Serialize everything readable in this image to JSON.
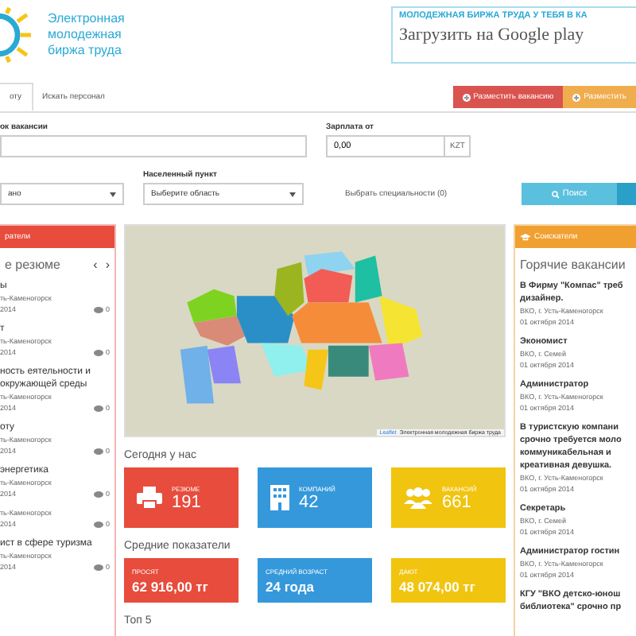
{
  "logo": {
    "lines": [
      "Электронная",
      "молодежная",
      "биржа труда"
    ]
  },
  "banner": {
    "headline": "МОЛОДЕЖНАЯ БИРЖА ТРУДА У ТЕБЯ В КА",
    "store": "Загрузить на Google play"
  },
  "tabs": [
    {
      "label": "оту",
      "selected": true
    },
    {
      "label": "Искать персонал",
      "selected": false
    }
  ],
  "actions": [
    {
      "label": "Разместить вакансию",
      "color": "#d9534f"
    },
    {
      "label": "Разместить",
      "color": "#f0ad4e"
    }
  ],
  "filters": {
    "keyword_label": "ок вакансии",
    "salary_label": "Зарплата от",
    "salary_value": "0,00",
    "currency": "KZT",
    "city_label": "Населенный пункт",
    "first_select": "ано",
    "region_placeholder": "Выберите область",
    "specialties": "Выбрать специальности (0)",
    "search_button": "Поиск"
  },
  "left_panel": {
    "header": "ратели",
    "title": "е резюме",
    "prev": "‹",
    "next": "›",
    "items": [
      {
        "title": "ы",
        "location": "ть-Каменогорск",
        "date": "2014",
        "views": "0"
      },
      {
        "title": "т",
        "location": "ть-Каменогорск",
        "date": "2014",
        "views": "0"
      },
      {
        "title": "ность еятельности и окружающей среды",
        "location": "ть-Каменогорск",
        "date": "2014",
        "views": "0"
      },
      {
        "title": "оту",
        "location": "ть-Каменогорск",
        "date": "2014",
        "views": "0"
      },
      {
        "title": "энергетика",
        "location": "ть-Каменогорск",
        "date": "2014",
        "views": "0"
      },
      {
        "location": "ть-Каменогорск",
        "date": "2014",
        "views": "0"
      },
      {
        "title": "ист в сфере туризма",
        "location": "ть-Каменогорск",
        "date": "2014",
        "views": "0"
      }
    ]
  },
  "map": {
    "attribution_link": "Leaflet",
    "attribution": "Электронная молодежная биржа труда"
  },
  "today": {
    "title": "Сегодня у нас",
    "tiles": [
      {
        "kind": "printer",
        "label": "РЕЗЮМЕ",
        "value": "191",
        "color": "#e74c3c"
      },
      {
        "kind": "building",
        "label": "КОМПАНИЙ",
        "value": "42",
        "color": "#3498db"
      },
      {
        "kind": "users",
        "label": "ВАКАНСИЙ",
        "value": "661",
        "color": "#f1c40f"
      }
    ]
  },
  "averages": {
    "title": "Средние показатели",
    "tiles": [
      {
        "label": "ПРОСЯТ",
        "value": "62 916,00 тг",
        "color": "#e74c3c"
      },
      {
        "label": "СРЕДНИЙ ВОЗРАСТ",
        "value": "24 года",
        "color": "#3498db"
      },
      {
        "label": "ДАЮТ",
        "value": "48 074,00 тг",
        "color": "#f1c40f"
      }
    ]
  },
  "top_title": "Топ 5",
  "right_panel": {
    "header": "Соискатели",
    "title": "Горячие вакансии",
    "items": [
      {
        "title": "В Фирму \"Компас\" треб дизайнер.",
        "location": "ВКО, г. Усть-Каменогорск",
        "date": "01 октября 2014"
      },
      {
        "title": "Экономист",
        "location": "ВКО, г. Семей",
        "date": "01 октября 2014"
      },
      {
        "title": "Администратор",
        "location": "ВКО, г. Усть-Каменогорск",
        "date": "01 октября 2014"
      },
      {
        "title": "В туристскую компани срочно требуется моло коммуникабельная и креативная девушка.",
        "location": "ВКО, г. Усть-Каменогорск",
        "date": "01 октября 2014"
      },
      {
        "title": "Секретарь",
        "location": "ВКО, г. Семей",
        "date": "01 октября 2014"
      },
      {
        "title": "Администратор гостин",
        "location": "ВКО, г. Усть-Каменогорск",
        "date": "01 октября 2014"
      },
      {
        "title": "КГУ \"ВКО детско-юнош библиотека\" срочно пр"
      }
    ]
  }
}
